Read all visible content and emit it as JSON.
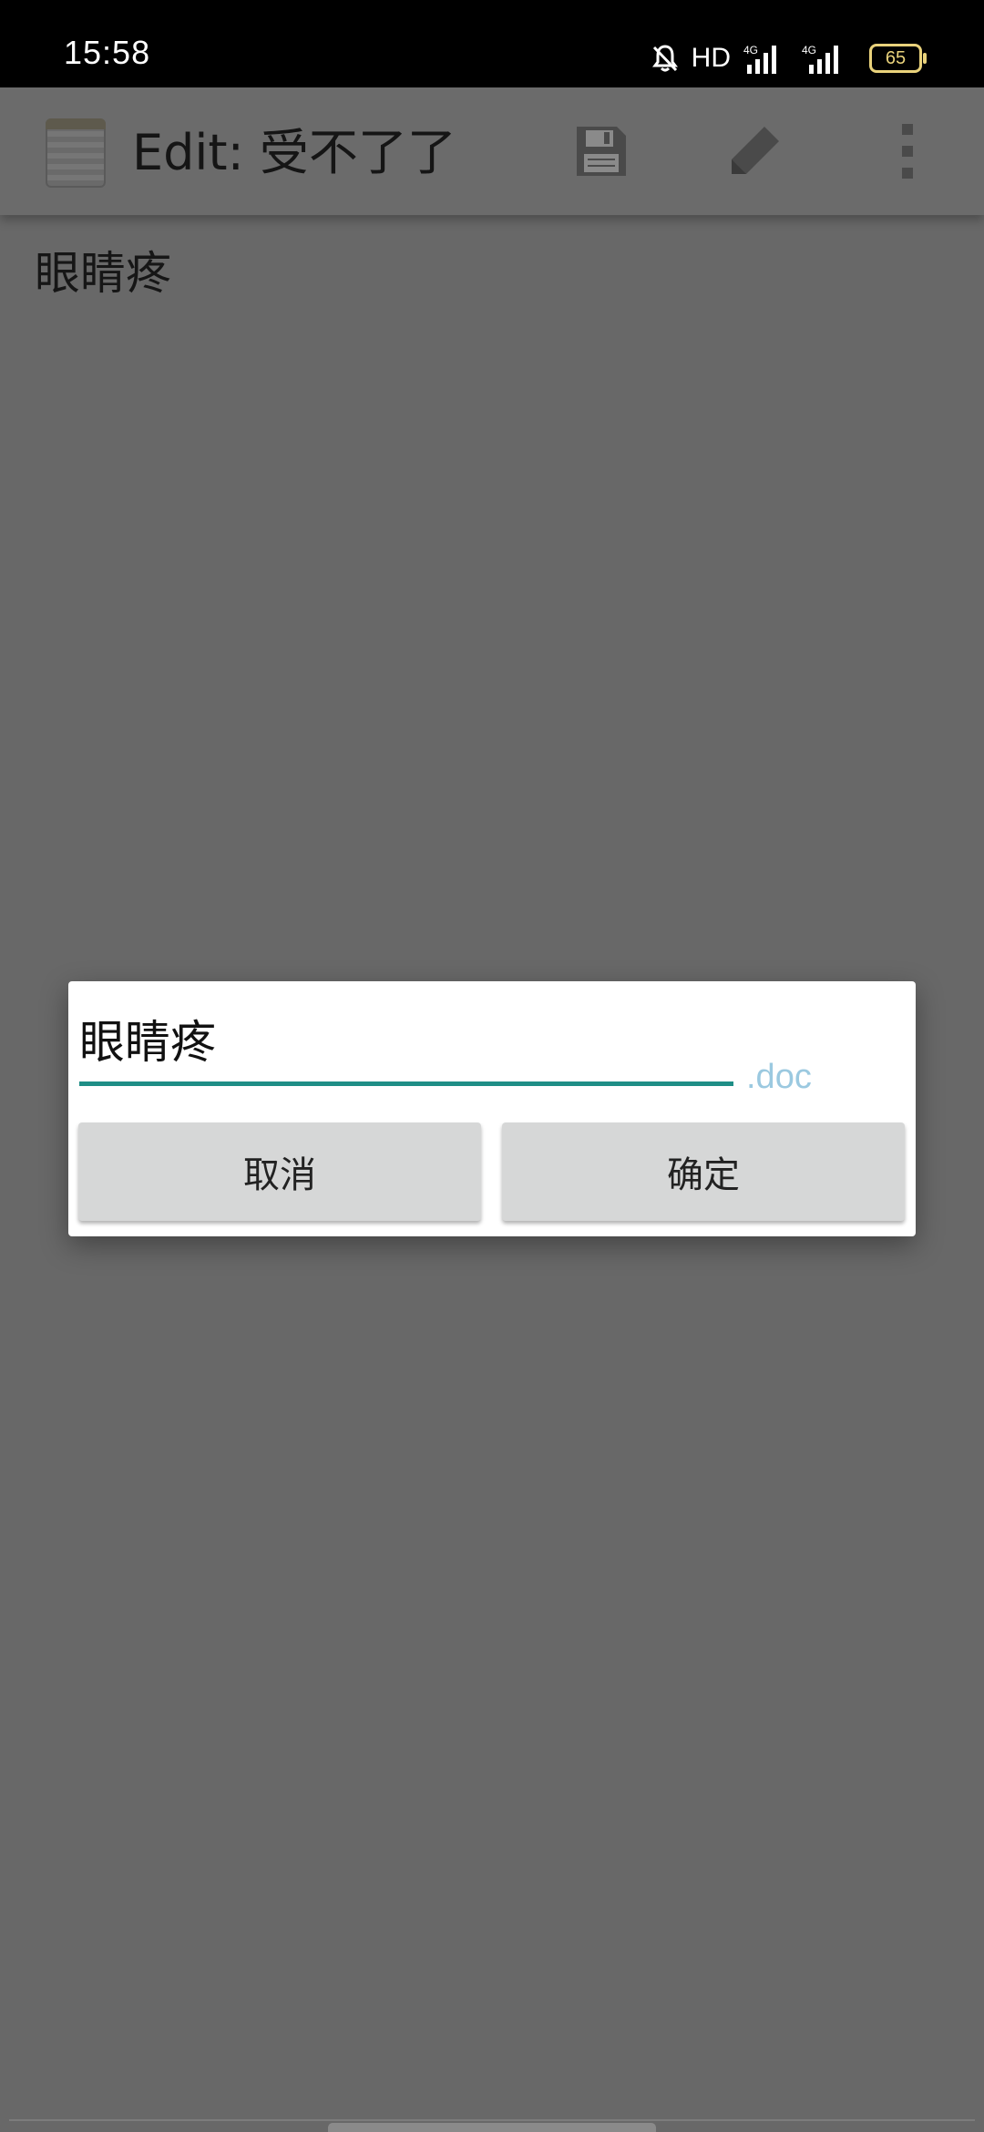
{
  "status_bar": {
    "time": "15:58",
    "hd_label": "HD",
    "network_1": "4G",
    "network_2": "4G",
    "battery_level": "65",
    "icons": [
      "bell-muted-icon",
      "hd-icon",
      "signal-icon",
      "signal-icon",
      "battery-icon"
    ]
  },
  "app_bar": {
    "title": "Edit: 受不了了",
    "actions": [
      "save-icon",
      "pencil-icon",
      "more-vert-icon"
    ]
  },
  "document": {
    "content": "眼睛疼"
  },
  "dialog": {
    "filename_value": "眼睛疼",
    "suffix": ".doc",
    "cancel_label": "取消",
    "ok_label": "确定",
    "accent_color": "#1f8e86"
  }
}
